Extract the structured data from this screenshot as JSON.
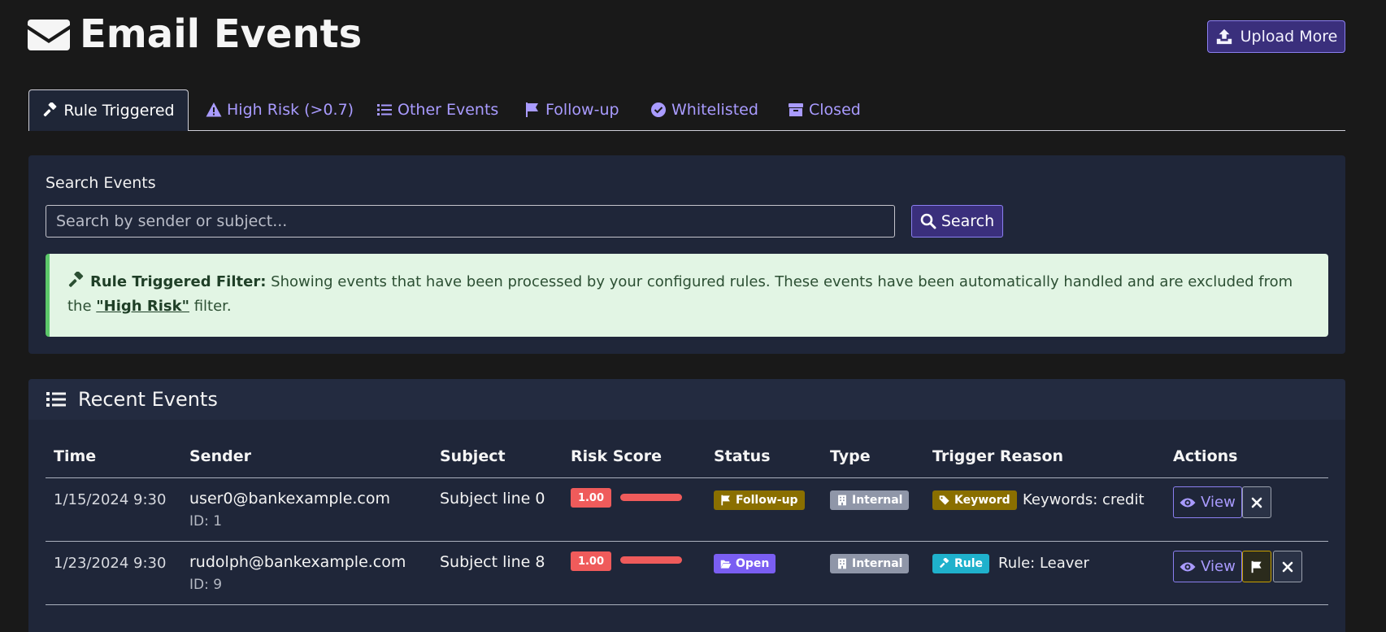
{
  "page": {
    "title": "Email Events",
    "upload_label": "Upload More"
  },
  "tabs": [
    {
      "label": "Rule Triggered",
      "icon": "gavel-icon"
    },
    {
      "label": "High Risk (>0.7)",
      "icon": "warning-icon"
    },
    {
      "label": "Other Events",
      "icon": "list-icon"
    },
    {
      "label": "Follow-up",
      "icon": "flag-icon"
    },
    {
      "label": "Whitelisted",
      "icon": "check-circle-icon"
    },
    {
      "label": "Closed",
      "icon": "archive-icon"
    }
  ],
  "search": {
    "label": "Search Events",
    "placeholder": "Search by sender or subject...",
    "button_label": "Search"
  },
  "alert": {
    "title": "Rule Triggered Filter:",
    "text_before": "Showing events that have been processed by your configured rules. These events have been automatically handled and are excluded from the",
    "link": "\"High Risk\"",
    "text_after": "filter."
  },
  "events": {
    "title": "Recent Events",
    "columns": [
      "Time",
      "Sender",
      "Subject",
      "Risk Score",
      "Status",
      "Type",
      "Trigger Reason",
      "Actions"
    ],
    "rows": [
      {
        "time": "1/15/2024 9:30",
        "sender": "user0@bankexample.com",
        "id": "ID: 1",
        "subject": "Subject line 0",
        "risk": "1.00",
        "risk_fraction": 1.0,
        "status": "Follow-up",
        "type": "Internal",
        "trigger_badge": "Keyword",
        "trigger_text": "Keywords: credit",
        "view_label": "View"
      },
      {
        "time": "1/23/2024 9:30",
        "sender": "rudolph@bankexample.com",
        "id": "ID: 9",
        "subject": "Subject line 8",
        "risk": "1.00",
        "risk_fraction": 1.0,
        "status": "Open",
        "type": "Internal",
        "trigger_badge": "Rule",
        "trigger_text": "Rule: Leaver",
        "view_label": "View"
      }
    ]
  },
  "colors": {
    "background": "#191919",
    "panel": "#1f2639",
    "accent": "#a99bff",
    "risk": "#ef5b5b",
    "alert_bg": "#e2f5e4"
  }
}
